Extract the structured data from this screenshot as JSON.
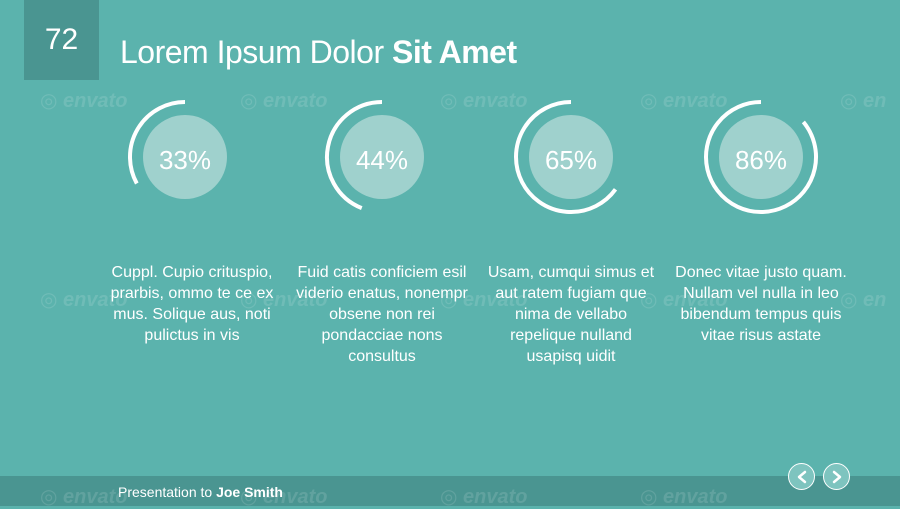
{
  "slide": {
    "number": "72",
    "title_regular": "Lorem Ipsum Dolor ",
    "title_bold": "Sit Amet"
  },
  "stats": [
    {
      "label": "33%",
      "value": 0.33,
      "description": "Cuppl. Cupio crituspio, prarbis, ommo te ce ex mus. Solique aus, noti pulictus in vis"
    },
    {
      "label": "44%",
      "value": 0.44,
      "description": "Fuid catis conficiem esil viderio enatus, nonempr obsene non rei pondacciae nons consultus"
    },
    {
      "label": "65%",
      "value": 0.65,
      "description": "Usam, cumqui simus et aut ratem fugiam que nima de vellabo repelique nulland usapisq uidit"
    },
    {
      "label": "86%",
      "value": 0.86,
      "description": "Donec vitae justo quam. Nullam vel nulla in leo bibendum tempus quis vitae risus astate"
    }
  ],
  "footer": {
    "prefix": "Presentation to ",
    "name": "Joe Smith"
  },
  "watermark_text": "envato",
  "colors": {
    "background": "#5bb3ad",
    "accent_dark": "#4a9591",
    "inner_circle": "#9fd1cd",
    "arc": "#ffffff"
  },
  "nav": {
    "prev_icon": "chevron-left-icon",
    "next_icon": "chevron-right-icon"
  }
}
